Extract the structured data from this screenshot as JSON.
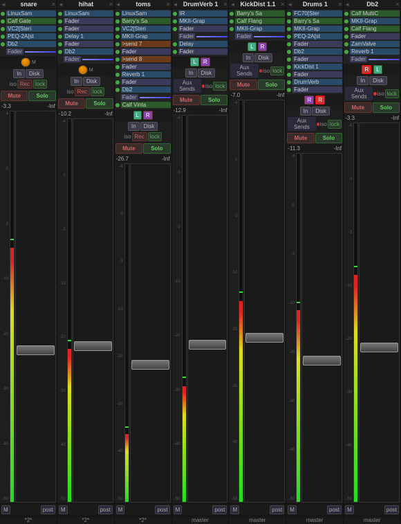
{
  "strips": [
    {
      "id": "snare",
      "title": "snare",
      "navLeft": "◄",
      "navRight": "►",
      "close": "✕",
      "plugins": [
        {
          "dot": "green",
          "name": "LinuxSam",
          "bg": "blue"
        },
        {
          "dot": "green",
          "name": "Calf Gate",
          "bg": "green"
        },
        {
          "dot": "green",
          "name": "VC2[Steri",
          "bg": "blue"
        },
        {
          "dot": "green",
          "name": "PEQ-2A[st",
          "bg": "blue"
        },
        {
          "dot": "green",
          "name": "Db2",
          "bg": "blue"
        },
        {
          "fader": true,
          "name": "Fader"
        }
      ],
      "hasMasterKnob": true,
      "knobColor": "orange",
      "lrMode": "none",
      "inDisk": [
        "In",
        "Disk"
      ],
      "recIso": true,
      "iso": false,
      "mute": "Mute",
      "solo": "Solo",
      "dbL": "-3.3",
      "dbR": "-Inf",
      "faderPos": 60,
      "meterLevel": 65,
      "bottomM": "M",
      "bottomPost": "post",
      "bottomName": "*2*"
    },
    {
      "id": "hihat",
      "title": "hihat",
      "navLeft": "◄",
      "navRight": "►",
      "close": "✕",
      "plugins": [
        {
          "dot": "green",
          "name": "LinuxSam",
          "bg": "blue"
        },
        {
          "dot": "green",
          "name": "Fader",
          "bg": "gray"
        },
        {
          "dot": "green",
          "name": "Fader",
          "bg": "gray"
        },
        {
          "dot": "green",
          "name": "Delay 1",
          "bg": "blue"
        },
        {
          "dot": "green",
          "name": "Fader",
          "bg": "gray"
        },
        {
          "dot": "green",
          "name": "Db2",
          "bg": "blue"
        },
        {
          "fader": true,
          "name": "Fader"
        }
      ],
      "hasMasterKnob": true,
      "knobColor": "orange",
      "lrMode": "none",
      "inDisk": [
        "In",
        "Disk"
      ],
      "recIso": true,
      "iso": false,
      "mute": "Mute",
      "solo": "Solo",
      "dbL": "-10.2",
      "dbR": "-Inf",
      "faderPos": 58,
      "meterLevel": 40,
      "bottomM": "M",
      "bottomPost": "post",
      "bottomName": "*2*"
    },
    {
      "id": "toms",
      "title": "toms",
      "navLeft": "◄",
      "navRight": "►",
      "close": "✕",
      "plugins": [
        {
          "dot": "green",
          "name": "LinuxSam",
          "bg": "blue"
        },
        {
          "dot": "green",
          "name": "Barry's Sa",
          "bg": "green"
        },
        {
          "dot": "green",
          "name": "VC2[Steri",
          "bg": "blue"
        },
        {
          "dot": "green",
          "name": "MKII-Grap",
          "bg": "blue"
        },
        {
          "dot": "green",
          "name": ">send 7",
          "bg": "orange"
        },
        {
          "dot": "green",
          "name": "Fader",
          "bg": "gray"
        },
        {
          "dot": "green",
          "name": ">send 8",
          "bg": "orange"
        },
        {
          "dot": "green",
          "name": "Fader",
          "bg": "gray"
        },
        {
          "dot": "green",
          "name": "Reverb 1",
          "bg": "blue"
        },
        {
          "dot": "green",
          "name": "Fader",
          "bg": "gray"
        },
        {
          "dot": "green",
          "name": "Db2",
          "bg": "blue"
        },
        {
          "fader": true,
          "name": "Fader"
        },
        {
          "dot": "green",
          "name": "Calf Vinta",
          "bg": "green"
        }
      ],
      "hasMasterKnob": false,
      "knobColor": "blue",
      "lrMode": "LR",
      "inDisk": [
        "In",
        "Disk"
      ],
      "recIso": true,
      "iso": false,
      "mute": "Mute",
      "solo": "Solo",
      "dbL": "-26.7",
      "dbR": "-Inf",
      "faderPos": 58,
      "meterLevel": 20,
      "bottomM": "M",
      "bottomPost": "post",
      "bottomName": "*2*"
    },
    {
      "id": "drumverb1",
      "title": "DrumVerb 1",
      "navLeft": "◄",
      "navRight": "►",
      "close": "✕",
      "plugins": [
        {
          "dot": "green",
          "name": "IR",
          "bg": "blue"
        },
        {
          "dot": "green",
          "name": "MKII-Grap",
          "bg": "blue"
        },
        {
          "dot": "green",
          "name": "Fader",
          "bg": "gray"
        },
        {
          "fader": true,
          "name": "Fader"
        },
        {
          "dot": "green",
          "name": "Delay",
          "bg": "blue"
        },
        {
          "dot": "green",
          "name": "Fader",
          "bg": "gray"
        }
      ],
      "hasMasterKnob": false,
      "knobColor": "none",
      "lrMode": "LR",
      "hasO1O2": true,
      "inDisk": [
        "In",
        "Disk"
      ],
      "recIso": false,
      "iso": true,
      "auxSends": "Aux\nSends",
      "mute": "Mute",
      "solo": "Solo",
      "dbL": "-12.9",
      "dbR": "-Inf",
      "faderPos": 58,
      "meterLevel": 30,
      "bottomM": "M",
      "bottomPost": "post",
      "bottomName": "master"
    },
    {
      "id": "kickdist11",
      "title": "KickDist 1.1",
      "navLeft": "◄",
      "navRight": "►",
      "close": "✕",
      "plugins": [
        {
          "dot": "green",
          "name": "Barry's Sa",
          "bg": "green"
        },
        {
          "dot": "green",
          "name": "Calf Flang",
          "bg": "green"
        },
        {
          "dot": "green",
          "name": "MKII-Grap",
          "bg": "blue"
        },
        {
          "fader": true,
          "name": "Fader"
        }
      ],
      "hasMasterKnob": false,
      "knobColor": "none",
      "lrMode": "LR",
      "hasO1O2": true,
      "inDisk": [
        "In",
        "Disk"
      ],
      "recIso": false,
      "iso": true,
      "auxSends": "Aux\nSends",
      "mute": "Mute",
      "solo": "Solo",
      "dbL": "-7.0",
      "dbR": "-Inf",
      "faderPos": 58,
      "meterLevel": 50,
      "bottomM": "M",
      "bottomPost": "post",
      "bottomName": "master"
    },
    {
      "id": "drums1",
      "title": "Drums 1",
      "navLeft": "◄",
      "navRight": "►",
      "close": "✕",
      "plugins": [
        {
          "dot": "green",
          "name": "FC70[Ster",
          "bg": "blue"
        },
        {
          "dot": "green",
          "name": "Barry's Sa",
          "bg": "green"
        },
        {
          "dot": "green",
          "name": "MKII-Grap",
          "bg": "blue"
        },
        {
          "dot": "green",
          "name": "PEQ-2A[st",
          "bg": "blue"
        },
        {
          "dot": "green",
          "name": "Fader",
          "bg": "gray"
        },
        {
          "dot": "green",
          "name": "Db2",
          "bg": "blue"
        },
        {
          "dot": "green",
          "name": "Fader",
          "bg": "gray"
        },
        {
          "dot": "green",
          "name": "KickDist 1",
          "bg": "blue"
        },
        {
          "dot": "green",
          "name": "Fader",
          "bg": "gray"
        },
        {
          "dot": "green",
          "name": "DrumVerb",
          "bg": "blue"
        },
        {
          "dot": "green",
          "name": "Fader",
          "bg": "gray"
        }
      ],
      "hasMasterKnob": false,
      "knobColor": "none",
      "lrMode": "RL",
      "hasO1O2": true,
      "inDisk": [
        "In",
        "Disk"
      ],
      "recIso": false,
      "iso": true,
      "auxSends": "Aux\nSends",
      "mute": "Mute",
      "solo": "Solo",
      "dbL": "-11.3",
      "dbR": "-Inf",
      "faderPos": 58,
      "meterLevel": 55,
      "bottomM": "M",
      "bottomPost": "post",
      "bottomName": "master"
    },
    {
      "id": "db2",
      "title": "Db2",
      "navLeft": "◄",
      "navRight": "►",
      "close": "✕",
      "plugins": [
        {
          "dot": "green",
          "name": "Calf MultiC",
          "bg": "green"
        },
        {
          "dot": "green",
          "name": "MKII-Grap",
          "bg": "blue"
        },
        {
          "dot": "green",
          "name": "Calf Flang",
          "bg": "green"
        },
        {
          "dot": "green",
          "name": "Fader",
          "bg": "gray"
        },
        {
          "dot": "green",
          "name": "ZamValve",
          "bg": "blue"
        },
        {
          "dot": "green",
          "name": "Reverb 1",
          "bg": "blue"
        },
        {
          "fader": true,
          "name": "Fader"
        }
      ],
      "hasMasterKnob": false,
      "knobColor": "none",
      "lrMode": "L_red",
      "hasO1O2": true,
      "inDisk": [
        "In",
        "Disk"
      ],
      "recIso": false,
      "iso": true,
      "auxSends": "Aux\nSends",
      "mute": "Mute",
      "solo": "Solo",
      "dbL": "-3.3",
      "dbR": "-Inf",
      "faderPos": 58,
      "meterLevel": 60,
      "bottomM": "M",
      "bottomPost": "post",
      "bottomName": "master"
    }
  ],
  "scale": [
    "-4",
    "0",
    "-3",
    "-10",
    "-20",
    "-30",
    "-40",
    "-50"
  ],
  "ui": {
    "mute": "Mute",
    "solo": "Solo",
    "in": "In",
    "disk": "Disk",
    "rec": "Rec",
    "lock": "lock",
    "iso": "iso",
    "aux": "Aux\nSends"
  }
}
